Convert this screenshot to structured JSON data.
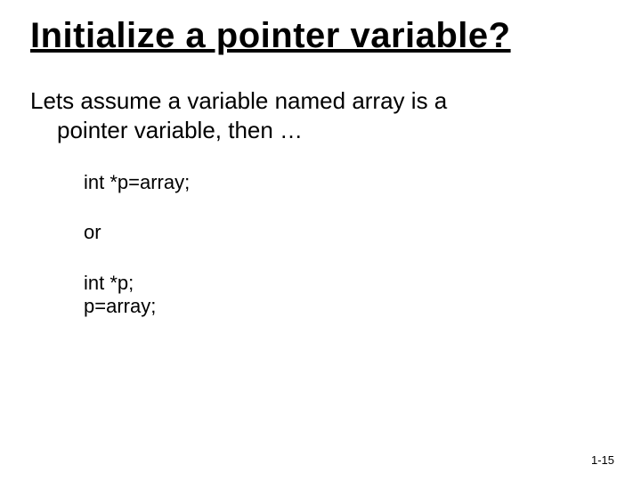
{
  "title": "Initialize a pointer variable?",
  "intro": {
    "line1_pre": "Lets assume a variable named ",
    "line1_var": "array",
    "line1_post": " is a",
    "line2": "pointer variable, then …"
  },
  "code1": "int *p=array;",
  "or": "or",
  "code2a": "int *p;",
  "code2b": "p=array;",
  "page": "1-15"
}
